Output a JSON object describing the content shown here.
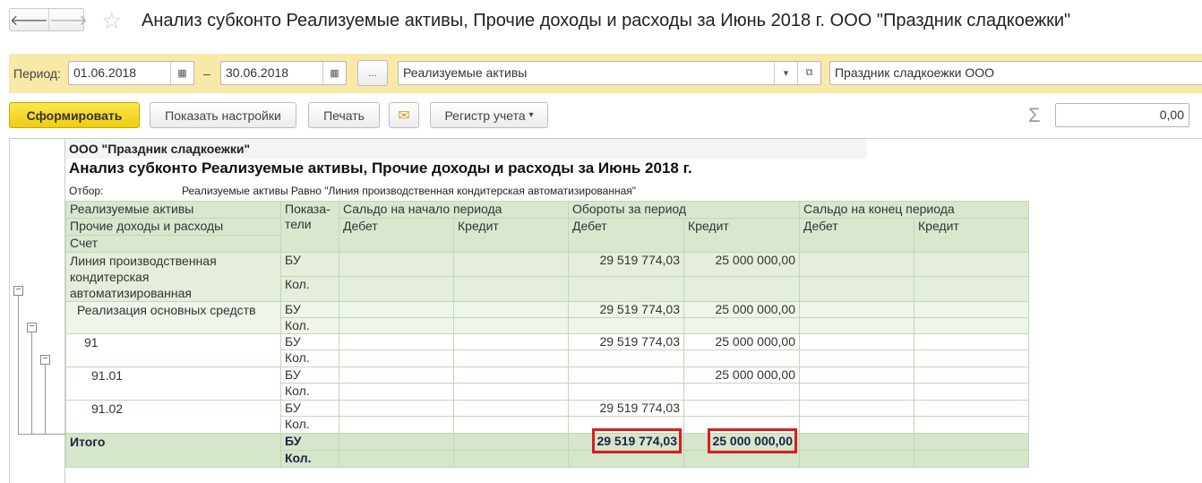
{
  "window": {
    "title": "Анализ субконто Реализуемые активы, Прочие доходы и расходы за Июнь 2018 г. ООО \"Праздник сладкоежки\"",
    "back": "🡐",
    "forward": "🡒",
    "star": "☆"
  },
  "filters": {
    "period_label": "Период:",
    "date_from": "01.06.2018",
    "dash": "–",
    "date_to": "30.06.2018",
    "more": "...",
    "subconto": "Реализуемые активы",
    "organization": "Праздник сладкоежки ООО"
  },
  "toolbar": {
    "generate": "Сформировать",
    "settings": "Показать настройки",
    "print": "Печать",
    "register": "Регистр учета",
    "sum_value": "0,00",
    "sigma": "Σ"
  },
  "report": {
    "org": "ООО \"Праздник сладкоежки\"",
    "title": "Анализ субконто Реализуемые активы, Прочие доходы и расходы за Июнь 2018 г.",
    "filter_label": "Отбор:",
    "filter_value": "Реализуемые активы Равно \"Линия производственная кондитерская автоматизированная\"",
    "headers": {
      "h1": "Реализуемые активы",
      "h2": "Прочие доходы и расходы",
      "h3": "Счет",
      "ind": "Показа-\nтели",
      "open": "Сальдо на начало периода",
      "turn": "Обороты за период",
      "close": "Сальдо на конец периода",
      "debit": "Дебет",
      "credit": "Кредит"
    },
    "rows": [
      {
        "name": "Линия производственная\nкондитерская\nавтоматизированная",
        "bu": "БУ",
        "kol": "Кол.",
        "turn_debit": "29 519 774,03",
        "turn_credit": "25 000 000,00"
      },
      {
        "name": "Реализация основных средств",
        "bu": "БУ",
        "kol": "Кол.",
        "turn_debit": "29 519 774,03",
        "turn_credit": "25 000 000,00"
      },
      {
        "name": "91",
        "bu": "БУ",
        "kol": "Кол.",
        "turn_debit": "29 519 774,03",
        "turn_credit": "25 000 000,00"
      },
      {
        "name": "91.01",
        "bu": "БУ",
        "kol": "Кол.",
        "turn_debit": "",
        "turn_credit": "25 000 000,00"
      },
      {
        "name": "91.02",
        "bu": "БУ",
        "kol": "Кол.",
        "turn_debit": "29 519 774,03",
        "turn_credit": ""
      }
    ],
    "total": {
      "name": "Итого",
      "bu": "БУ",
      "kol": "Кол.",
      "turn_debit": "29 519 774,03",
      "turn_credit": "25 000 000,00"
    }
  }
}
